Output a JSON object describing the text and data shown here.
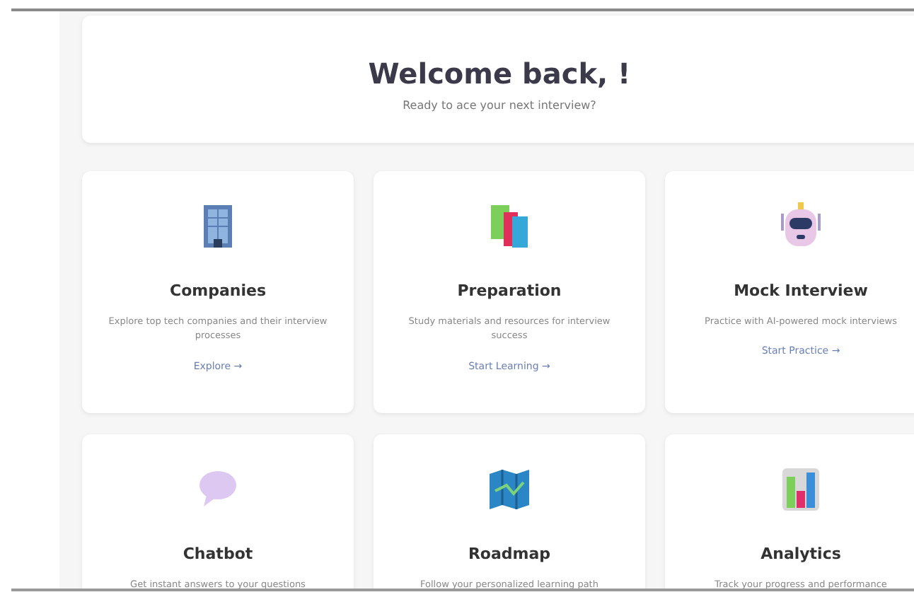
{
  "welcome": {
    "title": "Welcome back, !",
    "subtitle": "Ready to ace your next interview?"
  },
  "cards": [
    {
      "kind": "building",
      "title": "Companies",
      "description": "Explore top tech companies and their interview processes",
      "link": "Explore →"
    },
    {
      "kind": "books",
      "title": "Preparation",
      "description": "Study materials and resources for interview success",
      "link": "Start Learning →"
    },
    {
      "kind": "robot",
      "title": "Mock Interview",
      "description": "Practice with AI-powered mock interviews",
      "link": "Start Practice →"
    },
    {
      "kind": "chat",
      "title": "Chatbot",
      "description": "Get instant answers to your questions"
    },
    {
      "kind": "map",
      "title": "Roadmap",
      "description": "Follow your personalized learning path"
    },
    {
      "kind": "chart",
      "title": "Analytics",
      "description": "Track your progress and performance"
    }
  ]
}
